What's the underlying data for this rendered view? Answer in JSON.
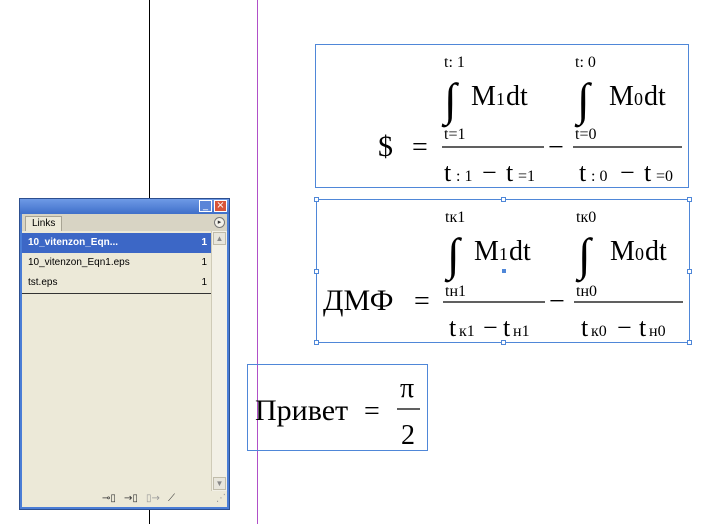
{
  "equation1": {
    "lhs": "$",
    "upper1": "t: 1",
    "lower1": "t=1",
    "integrand1_M": "M",
    "integrand1_sub": "1",
    "integrand1_dt": "dt",
    "den1_a": "t",
    "den1_a_sub": ": 1",
    "den1_b": "t",
    "den1_b_sub": "=1",
    "upper2": "t:  0",
    "lower2": "t=0",
    "integrand2_M": "M",
    "integrand2_sub": "0",
    "integrand2_dt": "dt",
    "den2_a": "t",
    "den2_a_sub": ":  0",
    "den2_b": "t",
    "den2_b_sub": "=0"
  },
  "equation2": {
    "lhs": "ДМФ",
    "upper1": "tк1",
    "lower1": "tн1",
    "integrand1_M": "M",
    "integrand1_sub": "1",
    "integrand1_dt": "dt",
    "den1_a": "t",
    "den1_a_sub": "к1",
    "den1_b": "t",
    "den1_b_sub": "н1",
    "upper2": "tк0",
    "lower2": "tн0",
    "integrand2_M": "M",
    "integrand2_sub": "0",
    "integrand2_dt": "dt",
    "den2_a": "t",
    "den2_a_sub": "к0",
    "den2_b": "t",
    "den2_b_sub": "н0"
  },
  "equation3": {
    "lhs": "Привет",
    "numerator": "π",
    "denominator": "2"
  },
  "symbols": {
    "equals": "=",
    "minus": "−",
    "integral": "∫"
  },
  "links_panel": {
    "tab_label": "Links",
    "items": [
      {
        "name": "10_vitenzon_Eqn...",
        "page": "1"
      },
      {
        "name": "10_vitenzon_Eqn1.eps",
        "page": "1"
      },
      {
        "name": "tst.eps",
        "page": "1"
      }
    ],
    "titlebar_minimize": "_",
    "titlebar_close": "×",
    "menu_glyph": "▸",
    "scroll_up": "▲",
    "scroll_down": "▼",
    "bottom_icons": [
      "relink-icon",
      "go-to-link-icon",
      "update-link-icon",
      "edit-original-icon"
    ],
    "colors": {
      "selection": "#3c67c6",
      "frame": "#4f87d8",
      "titlebar": "#4a7dd6"
    }
  }
}
